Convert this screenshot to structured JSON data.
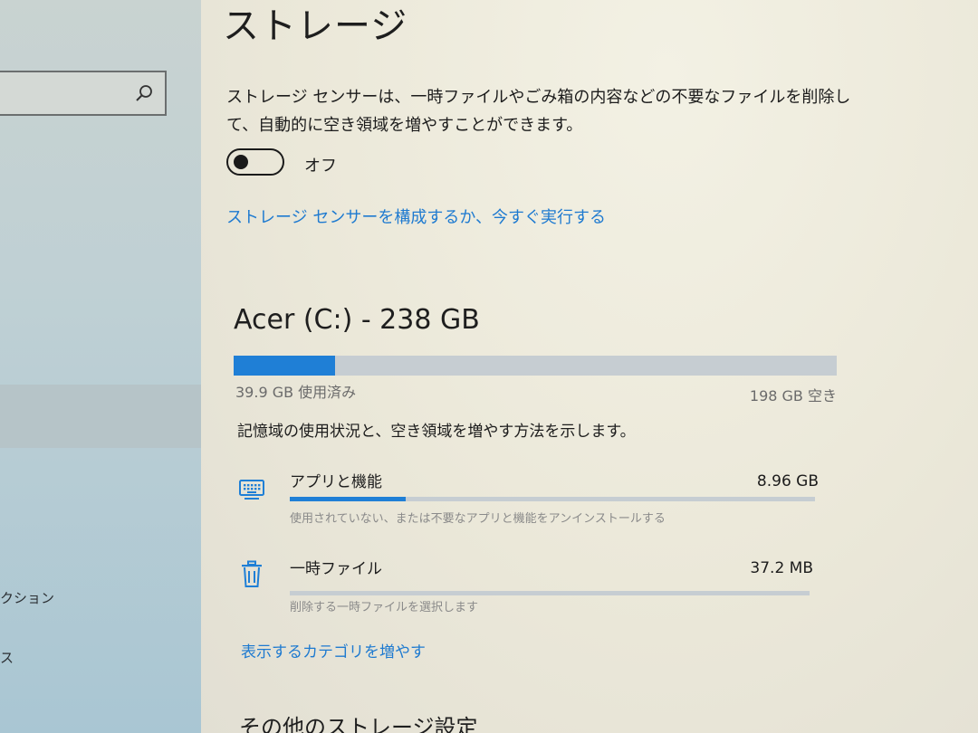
{
  "sidebar": {
    "search": {
      "placeholder": ""
    },
    "items": [
      {
        "label": "クション"
      },
      {
        "label": "ス"
      }
    ]
  },
  "main": {
    "title": "ストレージ",
    "storage_sense": {
      "description": "ストレージ センサーは、一時ファイルやごみ箱の内容などの不要なファイルを削除して、自動的に空き領域を増やすことができます。",
      "toggle_state": "オフ",
      "configure_link": "ストレージ センサーを構成するか、今すぐ実行する"
    },
    "drive": {
      "title": "Acer (C:) - 238 GB",
      "used_label": "39.9 GB 使用済み",
      "free_label": "198 GB 空き",
      "used_fraction": 0.168,
      "usage_description": "記憶域の使用状況と、空き領域を増やす方法を示します。"
    },
    "categories": [
      {
        "name": "アプリと機能",
        "size": "8.96 GB",
        "subtitle": "使用されていない、または不要なアプリと機能をアンインストールする",
        "icon": "keyboard-icon",
        "fill_fraction": 0.22
      },
      {
        "name": "一時ファイル",
        "size": "37.2 MB",
        "subtitle": "削除する一時ファイルを選択します",
        "icon": "trash-icon",
        "fill_fraction": 0.0
      }
    ],
    "more_categories_link": "表示するカテゴリを増やす",
    "other_settings_heading": "その他のストレージ設定"
  },
  "colors": {
    "accent": "#1f7fd6",
    "link": "#1e7ad0",
    "bar_track": "#c6cdd2"
  }
}
